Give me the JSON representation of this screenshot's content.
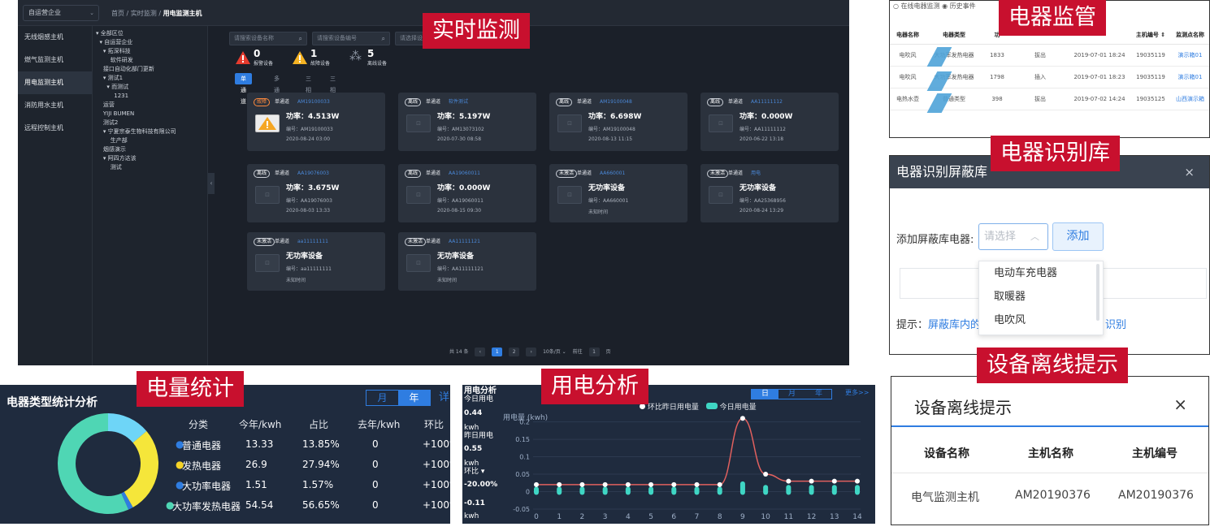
{
  "banners": {
    "monitor": "实时监测",
    "device": "电器监管",
    "library": "电器识别库",
    "offline": "设备离线提示",
    "energy": "电量统计",
    "usage": "用电分析"
  },
  "monitor": {
    "company_select": "自运营企业",
    "breadcrumb_home": "首页",
    "breadcrumb_mid": "实时监测",
    "breadcrumb_current": "用电监测主机",
    "nav": [
      "无线烟感主机",
      "燃气监测主机",
      "用电监测主机",
      "消防用水主机",
      "远程控制主机"
    ],
    "tree": [
      "▾ 全部区位",
      "  ▾ 自运营企业",
      "    ▾ 拓深科技",
      "        软件研发",
      "    接口自动化部门更新",
      "    ▾ 测试1",
      "      ▾ 而测试",
      "          1231",
      "    运营",
      "    YIJI BUMEN",
      "    测试2",
      "    ▾ 宁夏宗泰生物科技有限公司",
      "        生产部",
      "    烟感演示",
      "    ▾ 阿四方达该",
      "        测试"
    ],
    "search": [
      "请搜索设备名称",
      "请搜索设备编号",
      "请选择设备状态"
    ],
    "stats": [
      {
        "num": "0",
        "label": "报警设备"
      },
      {
        "num": "1",
        "label": "故障设备"
      },
      {
        "num": "5",
        "label": "离线设备"
      }
    ],
    "tabs": [
      "单通道",
      "多通道",
      "三相",
      "三相计量"
    ],
    "cards": [
      {
        "status": "故障",
        "channel": "单通道",
        "id": "AM19100033",
        "power": "功率：4.513W",
        "no": "编号：AM19100033",
        "time": "2020-08-24 03:00"
      },
      {
        "status": "离线",
        "channel": "单通道",
        "id": "软件测试",
        "power": "功率：5.197W",
        "no": "编号：AM13073102",
        "time": "2020-07-30 08:58"
      },
      {
        "status": "离线",
        "channel": "单通道",
        "id": "AM19100048",
        "power": "功率：6.698W",
        "no": "编号：AM19100048",
        "time": "2020-08-13 11:15"
      },
      {
        "status": "离线",
        "channel": "单通道",
        "id": "AA11111112",
        "power": "功率：0.000W",
        "no": "编号：AA11111112",
        "time": "2020-06-22 13:18"
      },
      {
        "status": "离线",
        "channel": "单通道",
        "id": "AA19076003",
        "power": "功率：3.675W",
        "no": "编号：AA19076003",
        "time": "2020-08-03 13:33"
      },
      {
        "status": "离线",
        "channel": "单通道",
        "id": "AA19060011",
        "power": "功率：0.000W",
        "no": "编号：AA19060011",
        "time": "2020-08-15 09:30"
      },
      {
        "status": "未激活",
        "channel": "单通道",
        "id": "AA660001",
        "power": "无功率设备",
        "no": "编号：AA660001",
        "time": "未知时间"
      },
      {
        "status": "未激活",
        "channel": "单通道",
        "id": "用电",
        "power": "无功率设备",
        "no": "编号：AA25368956",
        "time": "2020-08-24 13:29"
      },
      {
        "status": "未激活",
        "channel": "单通道",
        "id": "aa11111111",
        "power": "无功率设备",
        "no": "编号：aa11111111",
        "time": "未知时间"
      },
      {
        "status": "未激活",
        "channel": "单通道",
        "id": "AA11111121",
        "power": "无功率设备",
        "no": "编号：AA11111121",
        "time": "未知时间"
      }
    ],
    "pager": {
      "total": "共 14 条",
      "page1": "1",
      "page2": "2",
      "size": "10条/页 ⌄",
      "goto": "前往",
      "goto_val": "1",
      "unit": "页"
    }
  },
  "device": {
    "top_text": "○ 在线电器监测 ◉ 历史事件",
    "headers": [
      "电器名称",
      "电器类型",
      "功",
      "",
      "",
      "主机编号 ⇕",
      "监测点名称"
    ],
    "rows": [
      [
        "电吹风",
        "大功率发热电器",
        "1833",
        "拔出",
        "2019-07-01 18:24",
        "19035119",
        "演示箱01"
      ],
      [
        "电吹风",
        "大功率发热电器",
        "1798",
        "插入",
        "2019-07-01 18:23",
        "19035119",
        "演示箱01"
      ],
      [
        "电热水壶",
        "普通类型",
        "398",
        "拔出",
        "2019-07-02 14:24",
        "19035125",
        "山西演示箱"
      ]
    ]
  },
  "library": {
    "title": "电器识别屏蔽库",
    "close": "×",
    "label": "添加屏蔽库电器:",
    "placeholder": "请选择",
    "add": "添加",
    "options": [
      "电动车充电器",
      "取暖器",
      "电吹风"
    ],
    "tip_prefix": "提示：",
    "tip_link": "屏蔽库内的",
    "tip_suffix": "识别"
  },
  "offline": {
    "title": "设备离线提示",
    "close": "×",
    "headers": [
      "设备名称",
      "主机名称",
      "主机编号"
    ],
    "row": [
      "电气监测主机",
      "AM20190376",
      "AM20190376"
    ]
  },
  "energy": {
    "title": "电器类型统计分析",
    "toggle": [
      "月",
      "年"
    ],
    "more": "详",
    "headers": [
      "分类",
      "今年/kwh",
      "占比",
      "去年/kwh",
      "环比"
    ],
    "rows": [
      {
        "name": "普通电器",
        "color": "#2f7de1",
        "kwh": "13.33",
        "pct": "13.85%",
        "last": "0",
        "ratio": "+100%"
      },
      {
        "name": "发热电器",
        "color": "#f5d327",
        "kwh": "26.9",
        "pct": "27.94%",
        "last": "0",
        "ratio": "+100%"
      },
      {
        "name": "大功率电器",
        "color": "#2f7de1",
        "kwh": "1.51",
        "pct": "1.57%",
        "last": "0",
        "ratio": "+100%"
      },
      {
        "name": "大功率发热电器",
        "color": "#4fd6b4",
        "kwh": "54.54",
        "pct": "56.65%",
        "last": "0",
        "ratio": "+100%"
      }
    ]
  },
  "usage": {
    "title": "用电分析",
    "today_label": "今日用电",
    "today_value": "0.44",
    "unit": "kwh",
    "yesterday_label": "昨日用电",
    "yesterday_value": "0.55",
    "ratio_label": "环比 ▾",
    "ratio_value": "-20.00%",
    "delta_value": "-0.11",
    "toggle": [
      "日",
      "月",
      "年"
    ],
    "more": "更多>>",
    "legend_yesterday": "环比昨日用电量",
    "legend_today": "今日用电量"
  },
  "chart_data": [
    {
      "type": "pie",
      "title": "电器类型统计分析",
      "labels": [
        "普通电器",
        "发热电器",
        "大功率电器",
        "大功率发热电器"
      ],
      "values": [
        13.85,
        27.94,
        1.57,
        56.65
      ],
      "colors": [
        "#6ed5f7",
        "#f5e63a",
        "#2f7de1",
        "#4fd6b4"
      ]
    },
    {
      "type": "line",
      "ylabel": "用电量 (kwh)",
      "x": [
        0,
        1,
        2,
        3,
        4,
        5,
        6,
        7,
        8,
        9,
        10,
        11,
        12,
        13,
        14
      ],
      "yticks": [
        -0.05,
        0,
        0.05,
        0.1,
        0.15,
        0.2
      ],
      "ylim": [
        -0.05,
        0.22
      ],
      "series": [
        {
          "name": "环比昨日用电量",
          "type": "line",
          "color": "#e0605e",
          "values": [
            0.02,
            0.02,
            0.02,
            0.02,
            0.02,
            0.02,
            0.02,
            0.02,
            0.02,
            0.21,
            0.05,
            0.03,
            0.03,
            0.03,
            0.03
          ]
        },
        {
          "name": "今日用电量",
          "type": "bar",
          "color": "#3fd6c4",
          "values": [
            0.005,
            0.005,
            0.005,
            0.005,
            0.005,
            0.005,
            0.005,
            0.005,
            0.005,
            0.02,
            0.01,
            0.01,
            0.01,
            0.01,
            0.01
          ]
        }
      ]
    }
  ]
}
